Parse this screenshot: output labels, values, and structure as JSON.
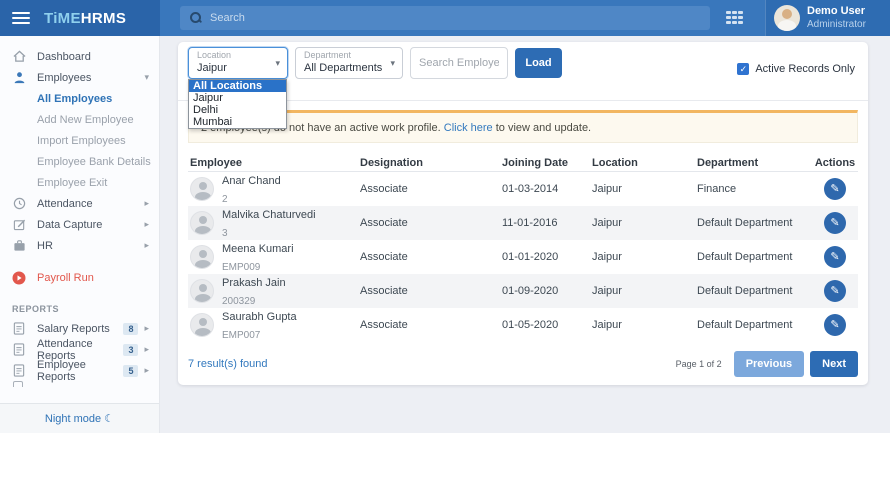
{
  "topbar": {
    "logo_time": "TiME",
    "logo_hrms": "HRMS",
    "search_placeholder": "Search",
    "user_name": "Demo User",
    "user_role": "Administrator"
  },
  "sidebar": {
    "dashboard": "Dashboard",
    "employees": "Employees",
    "employees_sub": [
      "All Employees",
      "Add New Employee",
      "Import Employees",
      "Employee Bank Details",
      "Employee Exit"
    ],
    "active_sub_item": "All Employees",
    "attendance": "Attendance",
    "data_capture": "Data Capture",
    "hr": "HR",
    "payroll_run": "Payroll Run",
    "reports_header": "REPORTS",
    "reports": [
      {
        "label": "Salary Reports",
        "badge": "8"
      },
      {
        "label": "Attendance Reports",
        "badge": "3"
      },
      {
        "label": "Employee Reports",
        "badge": "5"
      }
    ],
    "night_mode": "Night mode"
  },
  "filters": {
    "location_label": "Location",
    "location_value": "Jaipur",
    "department_label": "Department",
    "department_value": "All Departments",
    "search_placeholder": "Search Employee",
    "load_button": "Load",
    "active_records_label": "Active Records Only",
    "active_records_checked": true
  },
  "location_dropdown": {
    "selected": "All Locations",
    "options": [
      "All Locations",
      "Jaipur",
      "Delhi",
      "Mumbai"
    ]
  },
  "banner": {
    "text_before": "2 employee(s) do not have an active work profile. ",
    "link": "Click here",
    "text_after": " to view and update."
  },
  "table": {
    "headers": [
      "Employee",
      "Designation",
      "Joining Date",
      "Location",
      "Department",
      "Actions"
    ],
    "rows": [
      {
        "name": "Anar Chand",
        "code": "2",
        "designation": "Associate",
        "joining_date": "01-03-2014",
        "location": "Jaipur",
        "department": "Finance"
      },
      {
        "name": "Malvika Chaturvedi",
        "code": "3",
        "designation": "Associate",
        "joining_date": "11-01-2016",
        "location": "Jaipur",
        "department": "Default Department"
      },
      {
        "name": "Meena Kumari",
        "code": "EMP009",
        "designation": "Associate",
        "joining_date": "01-01-2020",
        "location": "Jaipur",
        "department": "Default Department"
      },
      {
        "name": "Prakash Jain",
        "code": "200329",
        "designation": "Associate",
        "joining_date": "01-09-2020",
        "location": "Jaipur",
        "department": "Default Department"
      },
      {
        "name": "Saurabh Gupta",
        "code": "EMP007",
        "designation": "Associate",
        "joining_date": "01-05-2020",
        "location": "Jaipur",
        "department": "Default Department"
      }
    ]
  },
  "footer": {
    "results_text": "7 result(s) found",
    "page_text": "Page 1 of 2",
    "previous_button": "Previous",
    "next_button": "Next"
  },
  "glyphs": {
    "chevron_down": "▾",
    "chevron_right": "▸",
    "moon": "☾",
    "pencil": "✎",
    "check": "✓"
  },
  "colors": {
    "topbar": "#3977bc",
    "topbar_left": "#2a64a9",
    "accent_blue": "#2f73b6",
    "button_blue": "#2d6cb4",
    "button_disabled": "#7ca8dc",
    "payroll_red": "#e2574c",
    "banner_border": "#f2b661",
    "banner_bg": "#fdf9ef",
    "row_stripe": "#f3f4f6",
    "dropdown_selected_bg": "#2a72c8"
  }
}
